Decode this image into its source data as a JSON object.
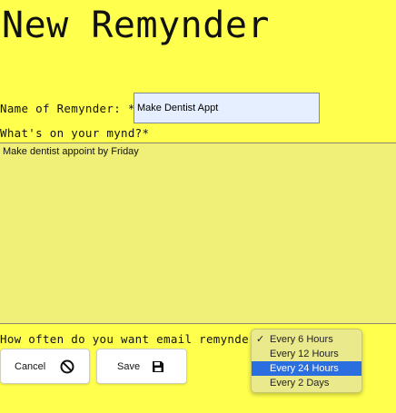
{
  "title": "New Remynder",
  "form": {
    "name_label": "Name of Remynder: *",
    "name_value": "Make Dentist Appt",
    "mynd_label": "What's on your mynd?*",
    "mynd_value": "Make dentist appoint by Friday",
    "email_label": "How often do you want email remynders?"
  },
  "buttons": {
    "cancel_label": "Cancel",
    "cancel_icon": "prohibited-icon",
    "save_label": "Save",
    "save_icon": "floppy-disk-icon"
  },
  "frequency_dropdown": {
    "checked_option": "Every 6 Hours",
    "highlighted_option": "Every 24 Hours",
    "options": [
      "Every 6 Hours",
      "Every 12 Hours",
      "Every 24 Hours",
      "Every 2 Days"
    ]
  },
  "colors": {
    "background": "#ffff4d",
    "text_area": "#f0f078",
    "input": "#e6efff",
    "highlight": "#2a6ee0"
  }
}
